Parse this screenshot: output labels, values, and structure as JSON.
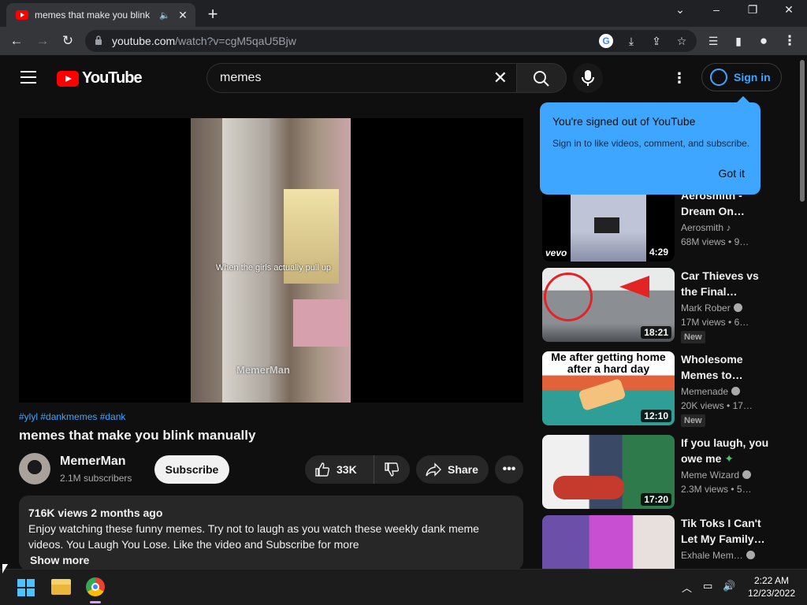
{
  "browser": {
    "tab_title": "memes that make you blink",
    "url_host": "youtube.com",
    "url_path": "/watch?v=cgM5qaU5Bjw"
  },
  "yt": {
    "logo_text": "YouTube",
    "search_query": "memes",
    "signin_label": "Sign in"
  },
  "player": {
    "caption": "When the girls actually pull up",
    "watermark": "MemerMan"
  },
  "video": {
    "tags": "#ylyl #dankmemes #dank",
    "title": "memes that make you blink manually",
    "channel": "MemerMan",
    "subscribers": "2.1M subscribers",
    "subscribe_label": "Subscribe",
    "likes": "33K",
    "share_label": "Share"
  },
  "description": {
    "meta": "716K views  2 months ago",
    "text": "Enjoy watching these funny memes. Try not to laugh as you watch these weekly dank meme videos. You Laugh You Lose. Like the video and Subscribe for more",
    "show_more": "Show more"
  },
  "popup": {
    "heading": "You're signed out of YouTube",
    "body": "Sign in to like videos, comment, and subscribe.",
    "button": "Got it"
  },
  "recommendations": [
    {
      "title": "Aerosmith - Dream On…",
      "channel": "Aerosmith",
      "views": "68M views",
      "age": "9…",
      "duration": "4:29",
      "thumb_label": "vevo",
      "badge": ""
    },
    {
      "title": "Car Thieves vs the Final…",
      "channel": "Mark Rober",
      "views": "17M views",
      "age": "6…",
      "duration": "18:21",
      "badge": "New"
    },
    {
      "title": "Wholesome Memes to…",
      "channel": "Memenade",
      "views": "20K views",
      "age": "17…",
      "duration": "12:10",
      "thumb_label": "Me after getting home after a hard day",
      "badge": "New"
    },
    {
      "title": "If you laugh, you owe me",
      "channel": "Meme Wizard",
      "views": "2.3M views",
      "age": "5…",
      "duration": "17:20",
      "badge": ""
    },
    {
      "title": "Tik Toks I Can't Let My Family…",
      "channel": "Exhale Mem…",
      "views": "",
      "age": "",
      "duration": "",
      "badge": ""
    }
  ],
  "taskbar": {
    "time": "2:22 AM",
    "date": "12/23/2022"
  },
  "colors": {
    "accent": "#3ea6ff",
    "youtube_red": "#ff0000",
    "background": "#0f0f0f"
  }
}
